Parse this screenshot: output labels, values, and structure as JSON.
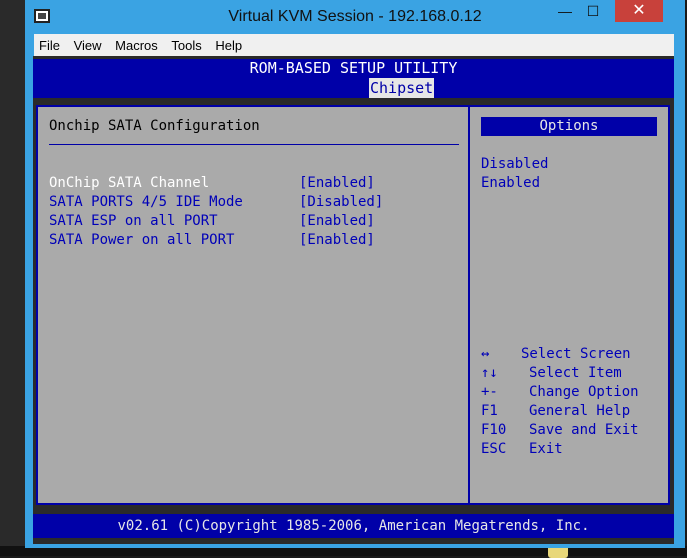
{
  "window": {
    "title": "Virtual KVM Session - 192.168.0.12",
    "minimize": "—",
    "maximize": "☐",
    "close": "✕"
  },
  "menu": [
    "File",
    "View",
    "Macros",
    "Tools",
    "Help"
  ],
  "bios": {
    "utility_title": "ROM-BASED SETUP UTILITY",
    "active_tab": "Chipset",
    "section_title": "Onchip SATA Configuration",
    "settings": [
      {
        "label": "OnChip SATA Channel",
        "value": "[Enabled]"
      },
      {
        "label": "SATA PORTS 4/5 IDE Mode",
        "value": "[Disabled]"
      },
      {
        "label": "SATA ESP on all PORT",
        "value": "[Enabled]"
      },
      {
        "label": "SATA Power on all PORT",
        "value": "[Enabled]"
      }
    ],
    "options_header": "Options",
    "options": [
      "Disabled",
      "Enabled"
    ],
    "help": [
      {
        "key": "↔",
        "desc": "Select Screen"
      },
      {
        "key": "↑↓",
        "desc": "Select Item"
      },
      {
        "key": "+-",
        "desc": "Change Option"
      },
      {
        "key": "F1",
        "desc": "General Help"
      },
      {
        "key": "F10",
        "desc": "Save and Exit"
      },
      {
        "key": "ESC",
        "desc": "Exit"
      }
    ],
    "footer": "v02.61 (C)Copyright 1985-2006, American Megatrends, Inc."
  },
  "colors": {
    "bios_blue": "#0000a8",
    "bios_gray": "#aaaaaa",
    "window_frame": "#3aa3e3",
    "close_red": "#c8413b"
  }
}
